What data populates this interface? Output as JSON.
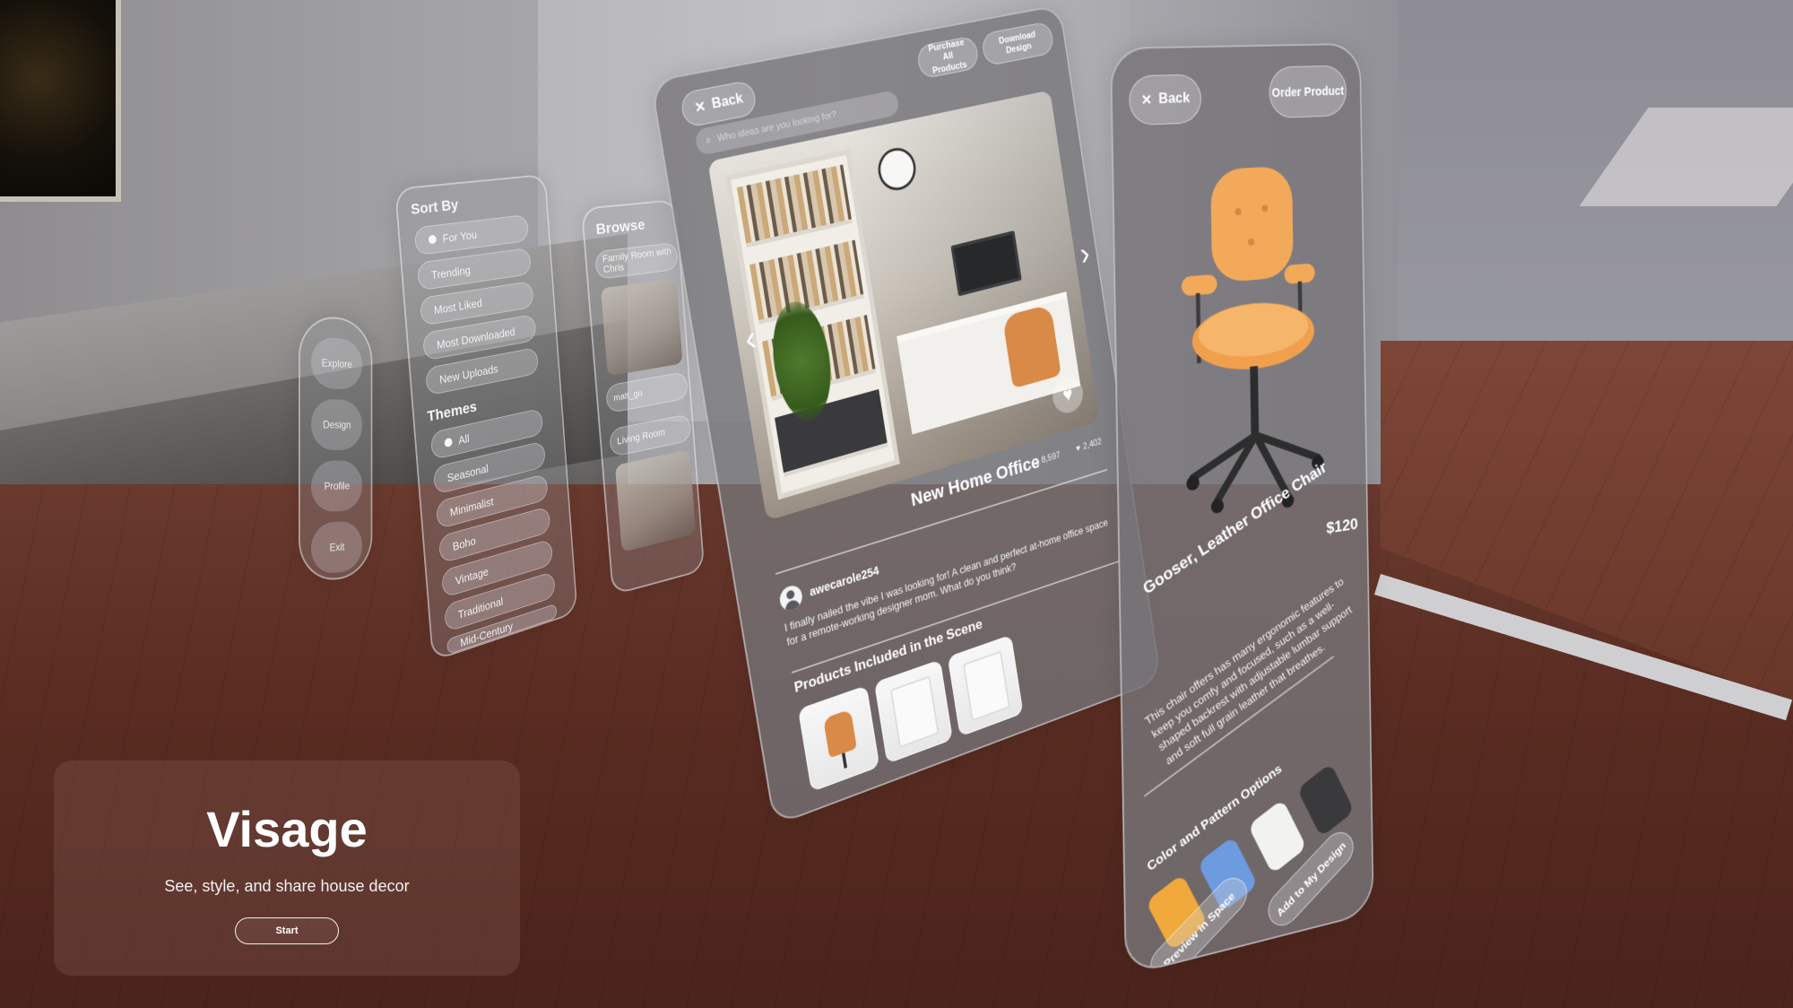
{
  "welcome": {
    "app_name": "Visage",
    "tagline": "See, style, and share house decor",
    "start_label": "Start"
  },
  "nav": {
    "items": [
      {
        "label": "Explore"
      },
      {
        "label": "Design"
      },
      {
        "label": "Profile"
      },
      {
        "label": "Exit"
      }
    ]
  },
  "sort": {
    "heading": "Sort By",
    "options": [
      {
        "label": "For You",
        "selected": true
      },
      {
        "label": "Trending"
      },
      {
        "label": "Most Liked"
      },
      {
        "label": "Most Downloaded"
      },
      {
        "label": "New Uploads"
      }
    ],
    "themes_heading": "Themes",
    "themes": [
      {
        "label": "All",
        "selected": true
      },
      {
        "label": "Seasonal"
      },
      {
        "label": "Minimalist"
      },
      {
        "label": "Boho"
      },
      {
        "label": "Vintage"
      },
      {
        "label": "Traditional"
      },
      {
        "label": "Mid-Century"
      }
    ]
  },
  "browse": {
    "heading": "Browse",
    "items": [
      {
        "label": "Family Room with Chris"
      },
      {
        "label": "matt_go"
      },
      {
        "label": "Living Room"
      }
    ]
  },
  "design": {
    "back_label": "Back",
    "search_placeholder": "Who ideas are you looking for?",
    "purchase_all_label": "Purchase All Products",
    "download_label": "Download Design",
    "title": "New Home Office",
    "downloads": "8,597",
    "likes": "2,402",
    "author": "awecarole254",
    "comment": "I finally nailed the vibe I was looking for! A clean and perfect at-home office space for a remote-working designer mom. What do you think?",
    "products_heading": "Products Included in the Scene",
    "icons": {
      "close": "close-icon",
      "prev": "chevron-left-icon",
      "next": "chevron-right-icon",
      "like": "heart-icon",
      "download": "download-icon",
      "search": "search-icon"
    }
  },
  "product": {
    "back_label": "Back",
    "order_label": "Order Product",
    "price": "$120",
    "name": "Gooser, Leather Office Chair",
    "description": "This chair offers has many ergonomic features to keep you comfy and focused, such as a well-shaped backrest with adjustable lumbar support and soft full grain leather that breathes.",
    "options_heading": "Color and Pattern Options",
    "swatches": [
      {
        "name": "orange",
        "color": "#f0a93a"
      },
      {
        "name": "blue",
        "color": "#6c9be0"
      },
      {
        "name": "white",
        "color": "#f2f2f0"
      },
      {
        "name": "black",
        "color": "#3a393c"
      }
    ],
    "preview_label": "Preview in Space",
    "add_label": "Add to My Design"
  }
}
